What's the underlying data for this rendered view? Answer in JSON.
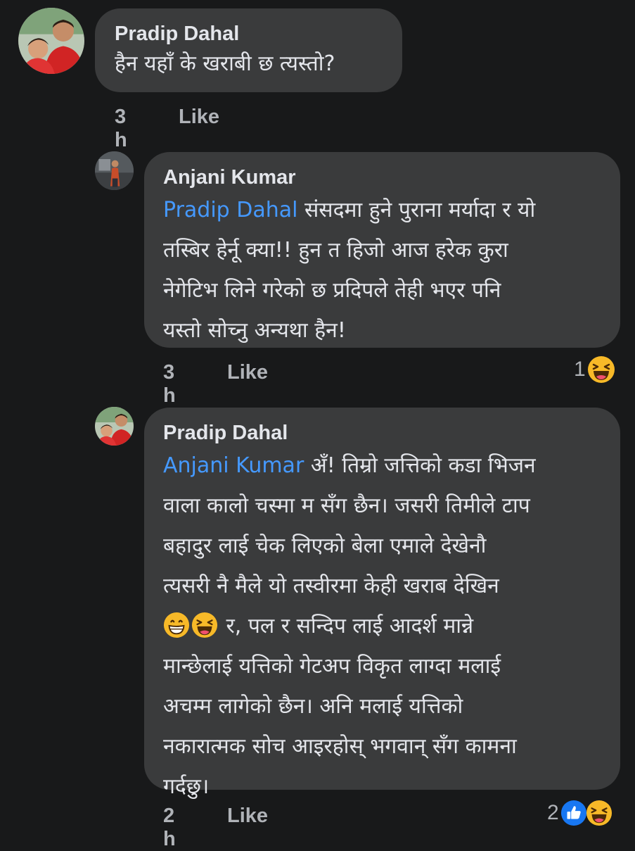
{
  "comments": [
    {
      "author": "Pradip Dahal",
      "text": "हैन यहाँ के खराबी छ त्यस्तो?",
      "time": "3 h",
      "like_label": "Like"
    },
    {
      "author": "Anjani Kumar",
      "mention": "Pradip Dahal",
      "line1": " संसदमा हुने पुराना मर्यादा र यो",
      "line2": "तस्बिर हेर्नू क्या!! हुन त हिजो आज हरेक कुरा",
      "line3": "नेगेटिभ लिने गरेको छ प्रदिपले तेही भएर पनि",
      "line4": "यस्तो सोच्नु अन्यथा हैन!",
      "time": "3 h",
      "like_label": "Like",
      "reaction_count": "1",
      "reaction_icons": [
        "haha-icon"
      ]
    },
    {
      "author": "Pradip Dahal",
      "mention": "Anjani Kumar",
      "line1": " अँ! तिम्रो जत्तिको कडा भिजन",
      "line2": "वाला कालो चस्मा म सँग छैन। जसरी तिमीले टाप",
      "line3": "बहादुर लाई चेक लिएको बेला एमाले देखेनौ",
      "line4": "त्यसरी नै मैले यो तस्वीरमा केही खराब देखिन",
      "line5": " र, पल र सन्दिप लाई आदर्श मान्ने",
      "line6": "मान्छेलाई यत्तिको गेटअप विकृत लाग्दा मलाई",
      "line7": "अचम्म लागेको छैन। अनि मलाई यत्तिको",
      "line8": "नकारात्मक सोच आइरहोस् भगवान् सँग कामना",
      "line9": "गर्दछु।",
      "inline_emojis": [
        "grin-emoji",
        "laughing-emoji"
      ],
      "time": "2 h",
      "like_label": "Like",
      "reaction_count": "2",
      "reaction_icons": [
        "like-icon",
        "haha-icon"
      ]
    }
  ],
  "colors": {
    "background": "#18191a",
    "bubble": "#3a3b3c",
    "text": "#e4e6eb",
    "meta": "#b0b3b8",
    "mention": "#4599ff",
    "like_blue": "#1877f2",
    "haha_yellow": "#f7b928"
  }
}
